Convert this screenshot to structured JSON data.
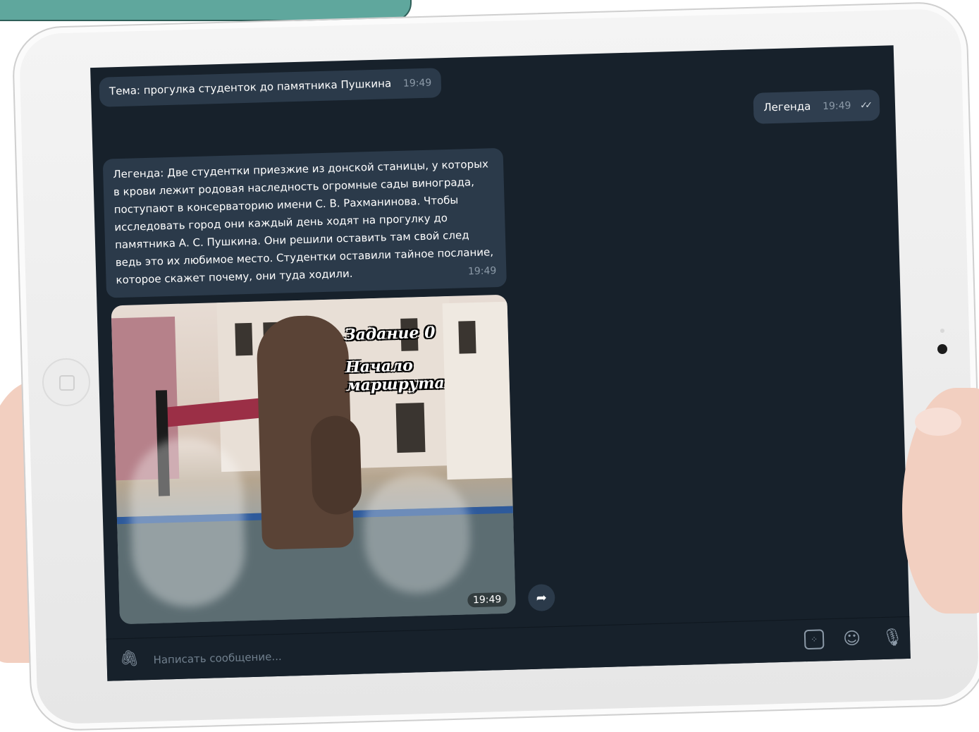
{
  "messages": {
    "topic": {
      "text": "Тема: прогулка студенток до памятника Пушкина",
      "time": "19:49"
    },
    "legend_short": {
      "text": "Легенда",
      "time": "19:49"
    },
    "legend_long": {
      "text": "Легенда: Две студентки приезжие из донской станицы, у которых в крови лежит родовая наследность огромные сады винограда, поступают в консерваторию имени С. В. Рахманинова. Чтобы исследовать город они каждый день ходят на прогулку до памятника А. С. Пушкина. Они решили оставить там свой след ведь это их любимое место. Студентки оставили тайное послание, которое скажет почему, они туда ходили.",
      "time": "19:49"
    },
    "photo": {
      "caption_line1": "Задание 0",
      "caption_line2": "Начало маршрута",
      "time": "19:49"
    }
  },
  "composer": {
    "placeholder": "Написать сообщение..."
  },
  "icons": {
    "attach": "paperclip-icon",
    "commands": "command-icon",
    "emoji": "emoji-icon",
    "mic": "microphone-icon",
    "share": "share-icon",
    "read": "double-check-icon"
  },
  "colors": {
    "chat_bg": "#17212b",
    "bubble": "#2b3a4a",
    "time": "#8b99a7",
    "banner": "#5fa79d"
  }
}
